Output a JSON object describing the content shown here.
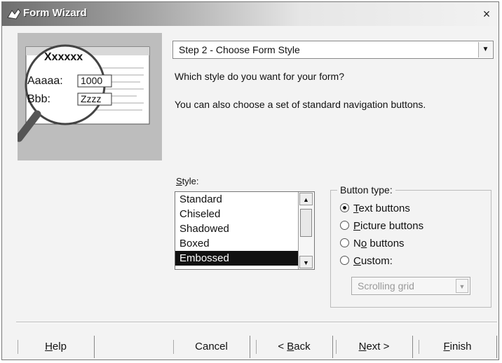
{
  "window": {
    "title": "Form Wizard",
    "close_glyph": "×"
  },
  "preview": {
    "heading": "Xxxxxx",
    "field1_label": "Aaaaa:",
    "field1_value": "1000",
    "field2_label": "Bbb:",
    "field2_value": "Zzzz",
    "icon": "magnifier-icon"
  },
  "step_select": {
    "value": "Step 2 - Choose Form Style"
  },
  "prompts": {
    "line1": "Which style do you want for your form?",
    "line2": "You can also choose a set of standard navigation buttons."
  },
  "style": {
    "label_mnemonic": "S",
    "label_rest": "tyle:",
    "items": [
      "Standard",
      "Chiseled",
      "Shadowed",
      "Boxed",
      "Embossed"
    ],
    "selected": "Embossed"
  },
  "button_type": {
    "title": "Button type:",
    "options": [
      {
        "mn": "T",
        "rest": "ext buttons",
        "pre": "",
        "checked": true
      },
      {
        "mn": "P",
        "rest": "icture buttons",
        "pre": "",
        "checked": false
      },
      {
        "mn": "o",
        "rest": " buttons",
        "pre": "N",
        "checked": false
      },
      {
        "mn": "C",
        "rest": "ustom:",
        "pre": "",
        "checked": false
      }
    ],
    "custom_select_value": "Scrolling grid"
  },
  "footer": {
    "help": {
      "mn": "H",
      "rest": "elp",
      "pre": ""
    },
    "cancel": "Cancel",
    "back": {
      "pre": "< ",
      "mn": "B",
      "rest": "ack"
    },
    "next": {
      "mn": "N",
      "rest": "ext >",
      "pre": ""
    },
    "finish": {
      "mn": "F",
      "rest": "inish",
      "pre": ""
    }
  },
  "colors": {
    "title_start": "#6e6e6e",
    "selection": "#111111"
  }
}
